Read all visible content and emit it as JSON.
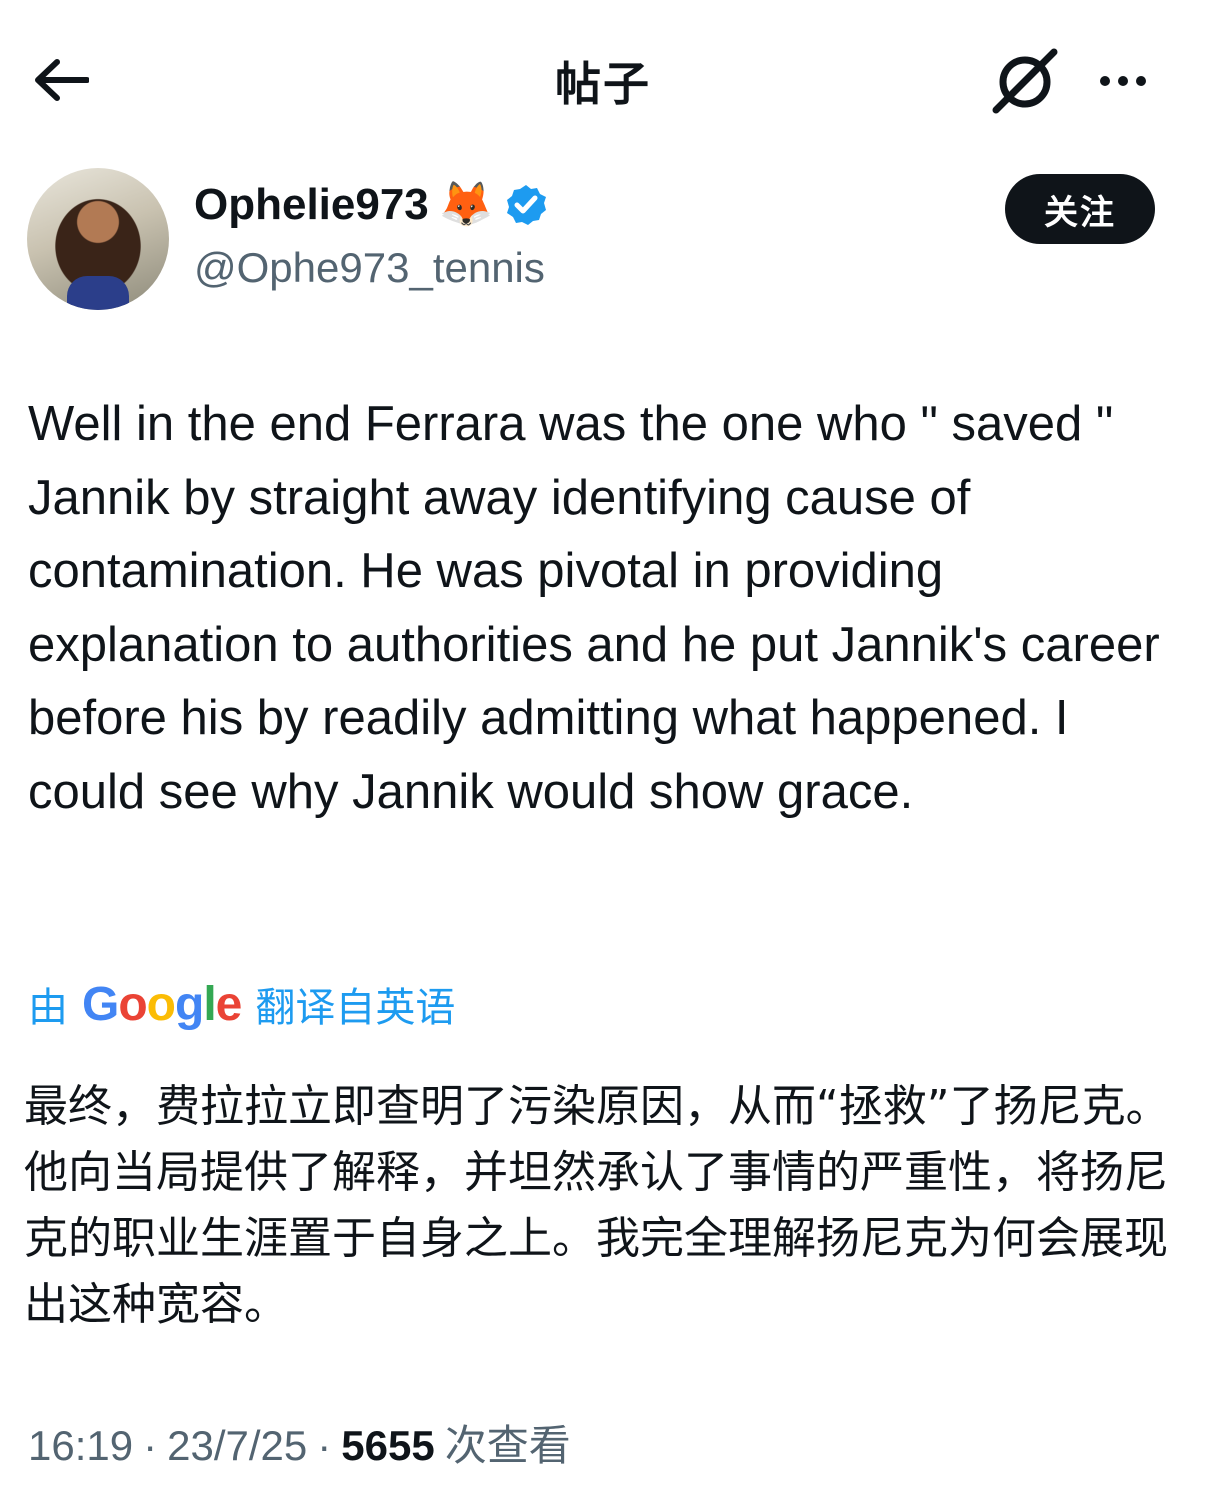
{
  "header": {
    "title": "帖子",
    "back_icon": "arrow-left-icon",
    "grok_icon": "grok-icon",
    "more_icon": "more-icon"
  },
  "author": {
    "name": "Ophelie973",
    "emoji": "🦊",
    "handle": "@Ophe973_tennis",
    "verified_color": "#1d9bf0",
    "follow_label": "关注"
  },
  "tweet": {
    "text": "Well in the end Ferrara was the one who \" saved \" Jannik by straight away identifying cause of contamination. He was pivotal in providing explanation to authorities and he put Jannik's career before his by readily admitting what happened. I could see why Jannik would show grace."
  },
  "translation": {
    "prefix": "由",
    "provider": "Google",
    "suffix": "翻译自英语",
    "text": "最终，费拉拉立即查明了污染原因，从而“拯救”了扬尼克。他向当局提供了解释，并坦然承认了事情的严重性，将扬尼克的职业生涯置于自身之上。我完全理解扬尼克为何会展现出这种宽容。"
  },
  "meta": {
    "time": "16:19",
    "sep1": "·",
    "date": "23/7/25",
    "sep2": "·",
    "views": "5655",
    "views_label": "次查看"
  }
}
